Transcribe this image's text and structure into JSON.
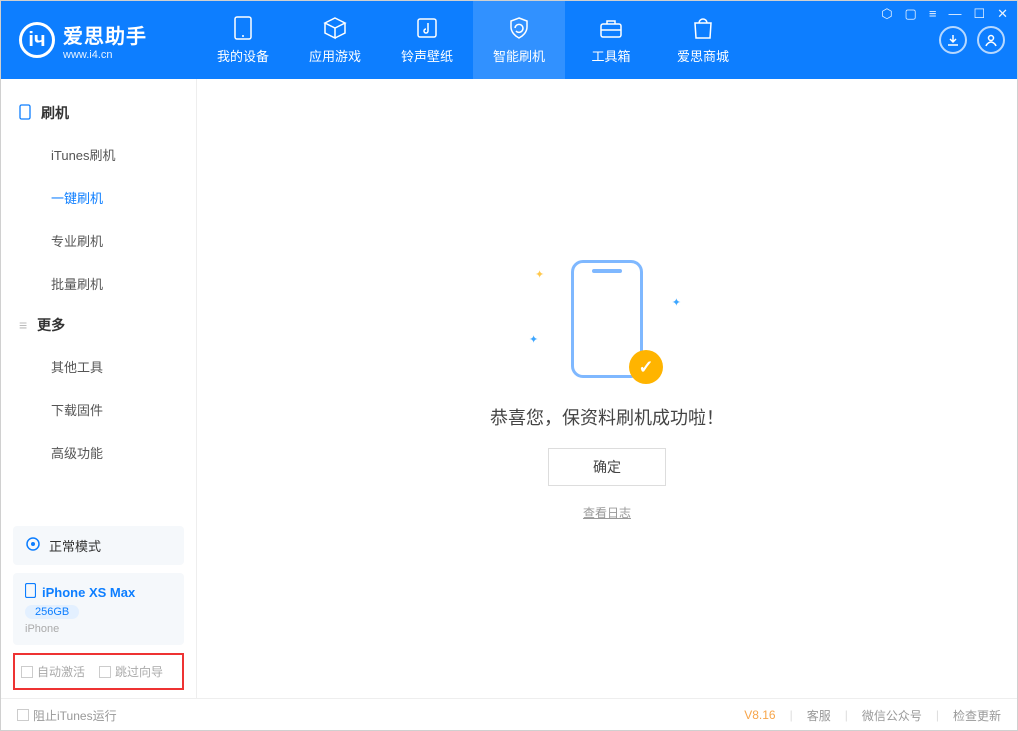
{
  "app": {
    "title": "爱思助手",
    "subtitle": "www.i4.cn"
  },
  "nav": [
    {
      "label": "我的设备"
    },
    {
      "label": "应用游戏"
    },
    {
      "label": "铃声壁纸"
    },
    {
      "label": "智能刷机"
    },
    {
      "label": "工具箱"
    },
    {
      "label": "爱思商城"
    }
  ],
  "sidebar": {
    "group1": {
      "title": "刷机",
      "items": [
        "iTunes刷机",
        "一键刷机",
        "专业刷机",
        "批量刷机"
      ]
    },
    "group2": {
      "title": "更多",
      "items": [
        "其他工具",
        "下载固件",
        "高级功能"
      ]
    }
  },
  "mode": {
    "label": "正常模式"
  },
  "device": {
    "name": "iPhone XS Max",
    "storage": "256GB",
    "type": "iPhone"
  },
  "checkboxes": {
    "auto_activate": "自动激活",
    "skip_guide": "跳过向导"
  },
  "main": {
    "success_text": "恭喜您，保资料刷机成功啦！",
    "ok_button": "确定",
    "view_log": "查看日志"
  },
  "footer": {
    "block_itunes": "阻止iTunes运行",
    "version": "V8.16",
    "links": [
      "客服",
      "微信公众号",
      "检查更新"
    ]
  }
}
